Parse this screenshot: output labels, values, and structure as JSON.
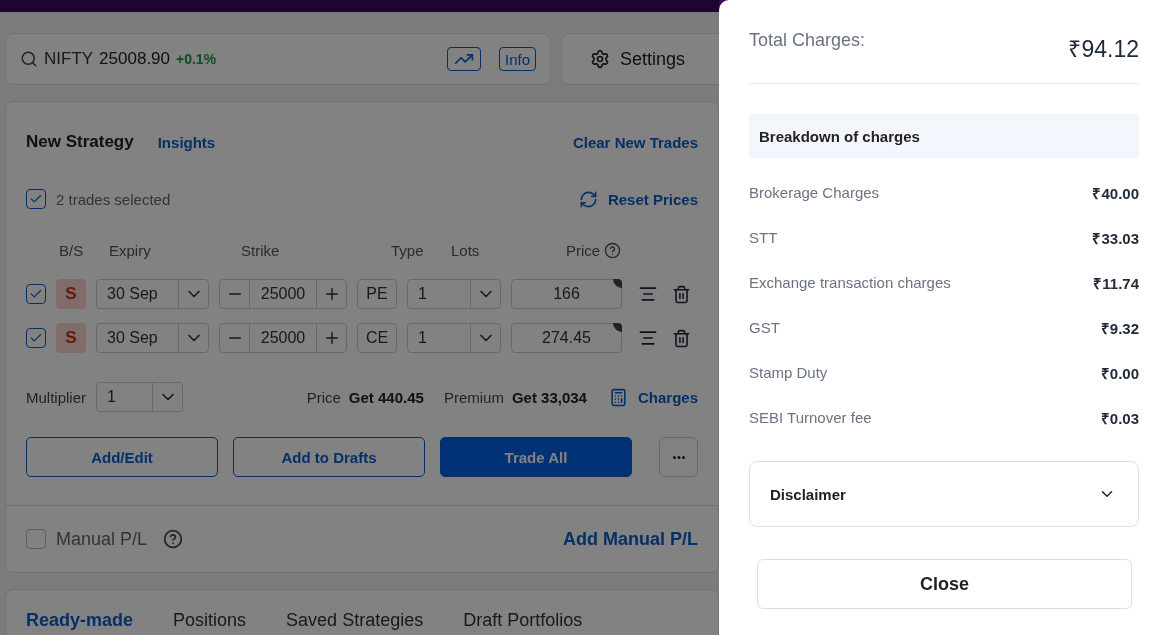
{
  "index_bar": {
    "symbol": "NIFTY",
    "price": "25008.90",
    "change": "+0.1%",
    "info_button": "Info"
  },
  "settings_button": "Settings",
  "strategy": {
    "title": "New Strategy",
    "insights_link": "Insights",
    "clear_link": "Clear New Trades",
    "select_all": {
      "checked": true,
      "label": "2 trades selected"
    },
    "reset_link": "Reset Prices",
    "columns": [
      "B/S",
      "Expiry",
      "Strike",
      "Type",
      "Lots",
      "Price"
    ],
    "trades": [
      {
        "checked": true,
        "side": "S",
        "expiry": "30 Sep",
        "strike": "25000",
        "type": "PE",
        "lots": "1",
        "price": "166"
      },
      {
        "checked": true,
        "side": "S",
        "expiry": "30 Sep",
        "strike": "25000",
        "type": "CE",
        "lots": "1",
        "price": "274.45"
      }
    ],
    "multiplier_label": "Multiplier",
    "multiplier": "1",
    "price_label": "Price",
    "price_value": "Get 440.45",
    "premium_label": "Premium",
    "premium_value": "Get 33,034",
    "charges_link": "Charges",
    "buttons": [
      {
        "label": "Add/Edit",
        "kind": "outline"
      },
      {
        "label": "Add to Drafts",
        "kind": "outline"
      },
      {
        "label": "Trade All",
        "kind": "primary"
      }
    ],
    "manual_pl": {
      "checked": false,
      "label": "Manual P/L",
      "add_link": "Add Manual P/L"
    }
  },
  "bottom_tabs": [
    {
      "label": "Ready-made",
      "selected": true
    },
    {
      "label": "Positions",
      "selected": false
    },
    {
      "label": "Saved Strategies",
      "selected": false
    },
    {
      "label": "Draft Portfolios",
      "selected": false
    }
  ],
  "charges_drawer": {
    "total_label": "Total Charges:",
    "total": "₹94.12",
    "breakdown_title": "Breakdown of charges",
    "items": [
      {
        "label": "Brokerage Charges",
        "value": "₹40.00"
      },
      {
        "label": "STT",
        "value": "₹33.03"
      },
      {
        "label": "Exchange transaction charges",
        "value": "₹11.74"
      },
      {
        "label": "GST",
        "value": "₹9.32"
      },
      {
        "label": "Stamp Duty",
        "value": "₹0.00"
      },
      {
        "label": "SEBI Turnover fee",
        "value": "₹0.03"
      }
    ],
    "disclaimer": {
      "label": "Disclaimer",
      "expanded": false
    },
    "close_button": "Close"
  }
}
